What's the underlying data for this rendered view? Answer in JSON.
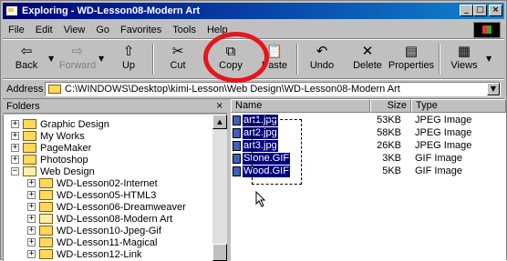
{
  "window": {
    "title": "Exploring - WD-Lesson08-Modern Art",
    "minimize": "_",
    "maximize": "□",
    "close": "×"
  },
  "menu": [
    {
      "label": "File"
    },
    {
      "label": "Edit"
    },
    {
      "label": "View"
    },
    {
      "label": "Go"
    },
    {
      "label": "Favorites"
    },
    {
      "label": "Tools"
    },
    {
      "label": "Help"
    }
  ],
  "toolbar": {
    "back": "Back",
    "forward": "Forward",
    "up": "Up",
    "cut": "Cut",
    "copy": "Copy",
    "paste": "Paste",
    "undo": "Undo",
    "delete": "Delete",
    "properties": "Properties",
    "views": "Views"
  },
  "address": {
    "label": "Address",
    "value": "C:\\WINDOWS\\Desktop\\kimi-Lesson\\Web Design\\WD-Lesson08-Modern Art"
  },
  "folders": {
    "header": "Folders",
    "close": "×",
    "items": [
      {
        "label": "Graphic Design",
        "expand": "+"
      },
      {
        "label": "My Works",
        "expand": "+"
      },
      {
        "label": "PageMaker",
        "expand": "+"
      },
      {
        "label": "Photoshop",
        "expand": "+"
      },
      {
        "label": "Web Design",
        "expand": "−"
      },
      {
        "label": "WD-Lesson02-Internet",
        "expand": "+"
      },
      {
        "label": "WD-Lesson05-HTML3",
        "expand": "+"
      },
      {
        "label": "WD-Lesson06-Dreamweaver",
        "expand": "+"
      },
      {
        "label": "WD-Lesson08-Modern Art",
        "expand": "+"
      },
      {
        "label": "WD-Lesson10-Jpeg-Gif",
        "expand": "+"
      },
      {
        "label": "WD-Lesson11-Magical",
        "expand": "+"
      },
      {
        "label": "WD-Lesson12-Link",
        "expand": "+"
      }
    ]
  },
  "filelist": {
    "columns": {
      "name": "Name",
      "size": "Size",
      "type": "Type"
    },
    "files": [
      {
        "name": "art1.jpg",
        "size": "53KB",
        "type": "JPEG Image"
      },
      {
        "name": "art2.jpg",
        "size": "58KB",
        "type": "JPEG Image"
      },
      {
        "name": "art3.jpg",
        "size": "26KB",
        "type": "JPEG Image"
      },
      {
        "name": "Stone.GIF",
        "size": "3KB",
        "type": "GIF Image"
      },
      {
        "name": "Wood.GIF",
        "size": "5KB",
        "type": "GIF Image"
      }
    ]
  }
}
